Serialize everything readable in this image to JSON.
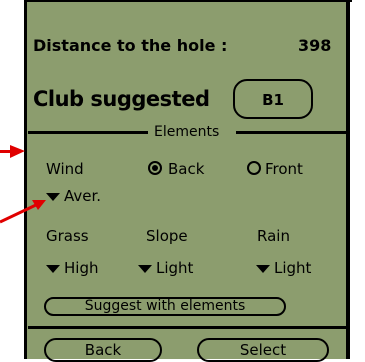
{
  "distance": {
    "label": "Distance to the hole :",
    "value": "398"
  },
  "club": {
    "label": "Club suggested",
    "value": "B1"
  },
  "elements": {
    "title": "Elements",
    "wind": {
      "label": "Wind",
      "option_back": "Back",
      "option_front": "Front",
      "selected": "Back",
      "strength": "Aver."
    },
    "grass": {
      "label": "Grass",
      "value": "High"
    },
    "slope": {
      "label": "Slope",
      "value": "Light"
    },
    "rain": {
      "label": "Rain",
      "value": "Light"
    }
  },
  "buttons": {
    "suggest": "Suggest with elements",
    "back": "Back",
    "select": "Select"
  },
  "colors": {
    "screen": "#8c9d6e",
    "annotation": "#e00000"
  }
}
